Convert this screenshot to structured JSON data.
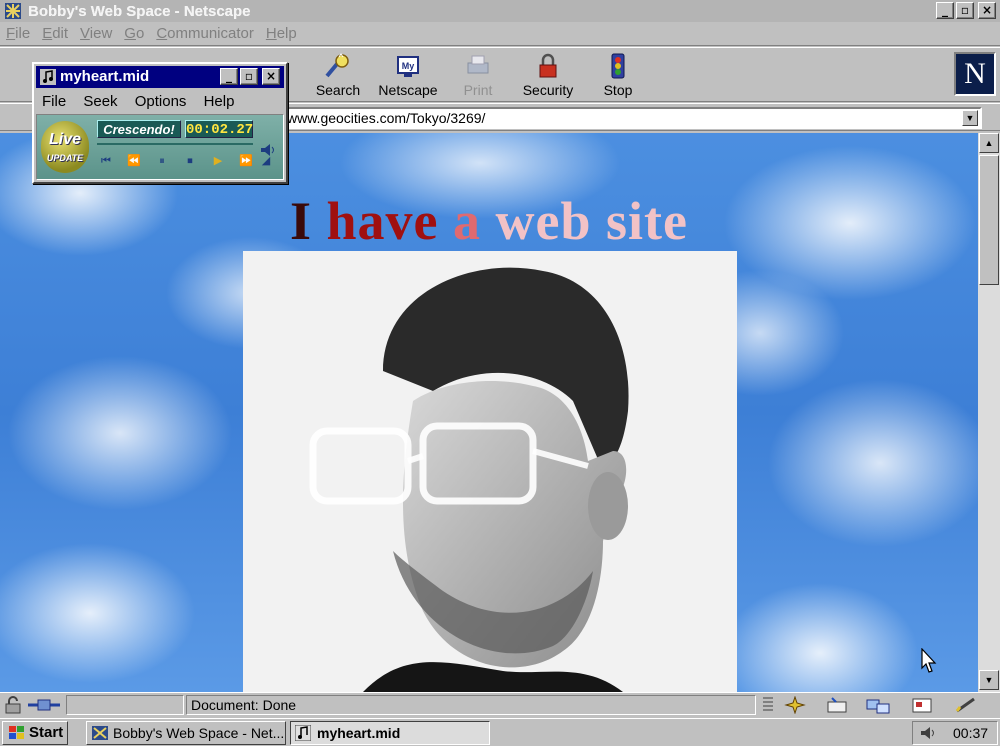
{
  "window": {
    "title": "Bobby's Web Space - Netscape"
  },
  "menu": [
    "File",
    "Edit",
    "View",
    "Go",
    "Communicator",
    "Help"
  ],
  "toolbar": {
    "buttons": [
      {
        "label": "Search",
        "icon": "search-icon"
      },
      {
        "label": "Netscape",
        "icon": "my-netscape-icon"
      },
      {
        "label": "Print",
        "icon": "print-icon",
        "disabled": true
      },
      {
        "label": "Security",
        "icon": "lock-icon"
      },
      {
        "label": "Stop",
        "icon": "stop-icon"
      }
    ],
    "netscape_logo": "N"
  },
  "location": {
    "url": "www.geocities.com/Tokyo/3269/"
  },
  "page": {
    "headline_words": [
      "I",
      "have",
      "a",
      "web",
      "site"
    ]
  },
  "status": {
    "text": "Document: Done"
  },
  "player": {
    "title": "myheart.mid",
    "menu": [
      "File",
      "Seek",
      "Options",
      "Help"
    ],
    "badge_top": "Live",
    "badge_bottom": "UPDATE",
    "label": "Crescendo!",
    "time": "00:02.27"
  },
  "taskbar": {
    "start": "Start",
    "tasks": [
      {
        "label": "Bobby's Web Space - Net...",
        "active": false
      },
      {
        "label": "myheart.mid",
        "active": true
      }
    ],
    "clock": "00:37"
  }
}
